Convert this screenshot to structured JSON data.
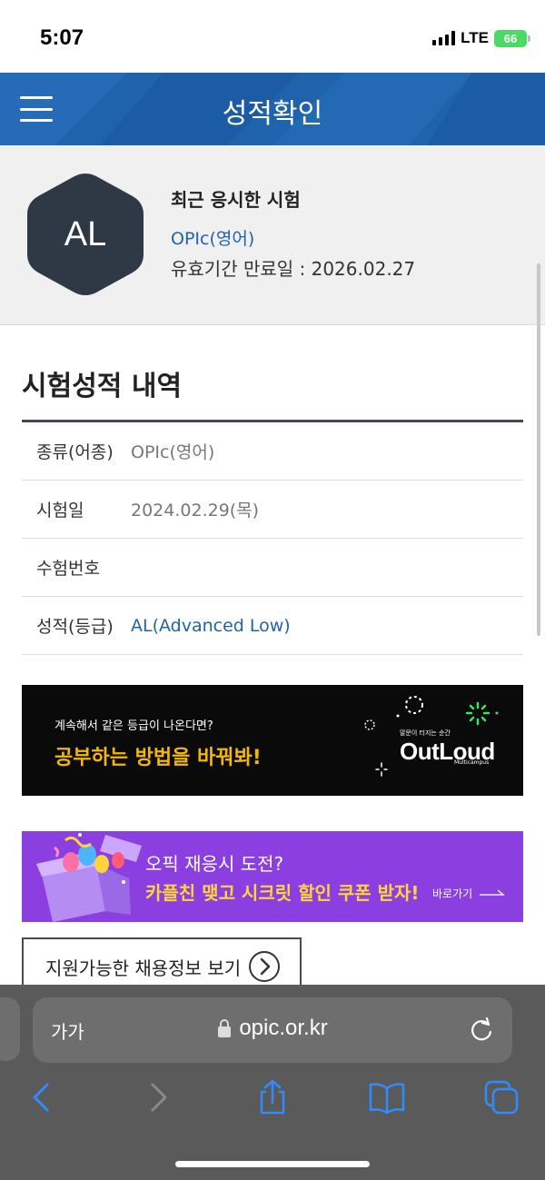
{
  "status_bar": {
    "time": "5:07",
    "network": "LTE",
    "battery": "66"
  },
  "header": {
    "title": "성적확인"
  },
  "recent_test": {
    "grade": "AL",
    "title": "최근 응시한 시험",
    "test_name": "OPIc(영어)",
    "expiry": "유효기간 만료일 : 2026.02.27"
  },
  "results": {
    "title": "시험성적 내역",
    "rows": [
      {
        "label": "종류(어종)",
        "value": "OPIc(영어)"
      },
      {
        "label": "시험일",
        "value": "2024.02.29(목)"
      },
      {
        "label": "수험번호",
        "value": ""
      },
      {
        "label": "성적(등급)",
        "value": "AL(Advanced Low)"
      }
    ]
  },
  "banners": {
    "outloud": {
      "sub": "계속해서 같은 등급이 나온다면?",
      "main": "공부하는 방법을 바꿔봐!",
      "tagline": "말문이 터지는 순간",
      "logo": "OutLoud",
      "logo_sub": "Multicampus"
    },
    "coupon": {
      "sub": "오픽 재응시 도전?",
      "main": "카플친 맺고 시크릿 할인 쿠폰 받자!",
      "link": "바로가기"
    }
  },
  "jobs_button": {
    "label": "지원가능한 채용정보 보기"
  },
  "safari": {
    "text_size": "가가",
    "url": "opic.or.kr"
  },
  "colors": {
    "header_blue": "#1f63ad",
    "dark_slate": "#2f3945",
    "banner_purple": "#8c3fe0",
    "banner_yellow": "#f5b800"
  }
}
